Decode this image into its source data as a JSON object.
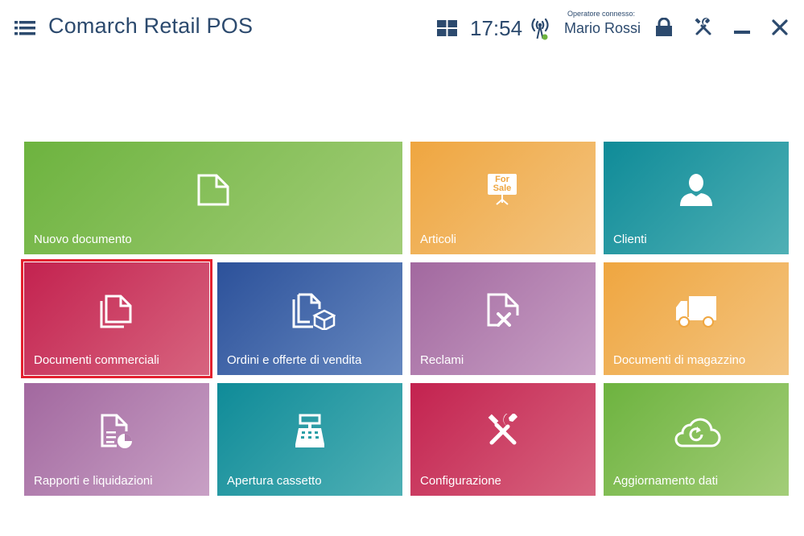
{
  "header": {
    "title": "Comarch Retail POS",
    "clock": "17:54",
    "operator_label": "Operatore connesso:",
    "operator_name": "Mario Rossi"
  },
  "colors": {
    "header_text": "#2c4a6e",
    "selection_border": "#e3202f",
    "green": "#6db33f",
    "orange": "#efa640",
    "teal": "#0f8b98",
    "crimson": "#c3224f",
    "blue": "#2c519a",
    "purple": "#a2689f"
  },
  "tiles": [
    {
      "label": "Nuovo documento",
      "icon": "document-icon"
    },
    {
      "label": "Articoli",
      "icon": "for-sale-sign-icon",
      "sign_line1": "For",
      "sign_line2": "Sale"
    },
    {
      "label": "Clienti",
      "icon": "person-icon"
    },
    {
      "label": "Documenti commerciali",
      "icon": "documents-stack-icon",
      "selected": true
    },
    {
      "label": "Ordini e offerte di vendita",
      "icon": "documents-box-icon"
    },
    {
      "label": "Reclami",
      "icon": "document-x-icon"
    },
    {
      "label": "Documenti di magazzino",
      "icon": "truck-icon"
    },
    {
      "label": "Rapporti e liquidazioni",
      "icon": "report-chart-icon"
    },
    {
      "label": "Apertura cassetto",
      "icon": "cash-register-icon"
    },
    {
      "label": "Configurazione",
      "icon": "tools-icon"
    },
    {
      "label": "Aggiornamento dati",
      "icon": "cloud-refresh-icon"
    }
  ]
}
